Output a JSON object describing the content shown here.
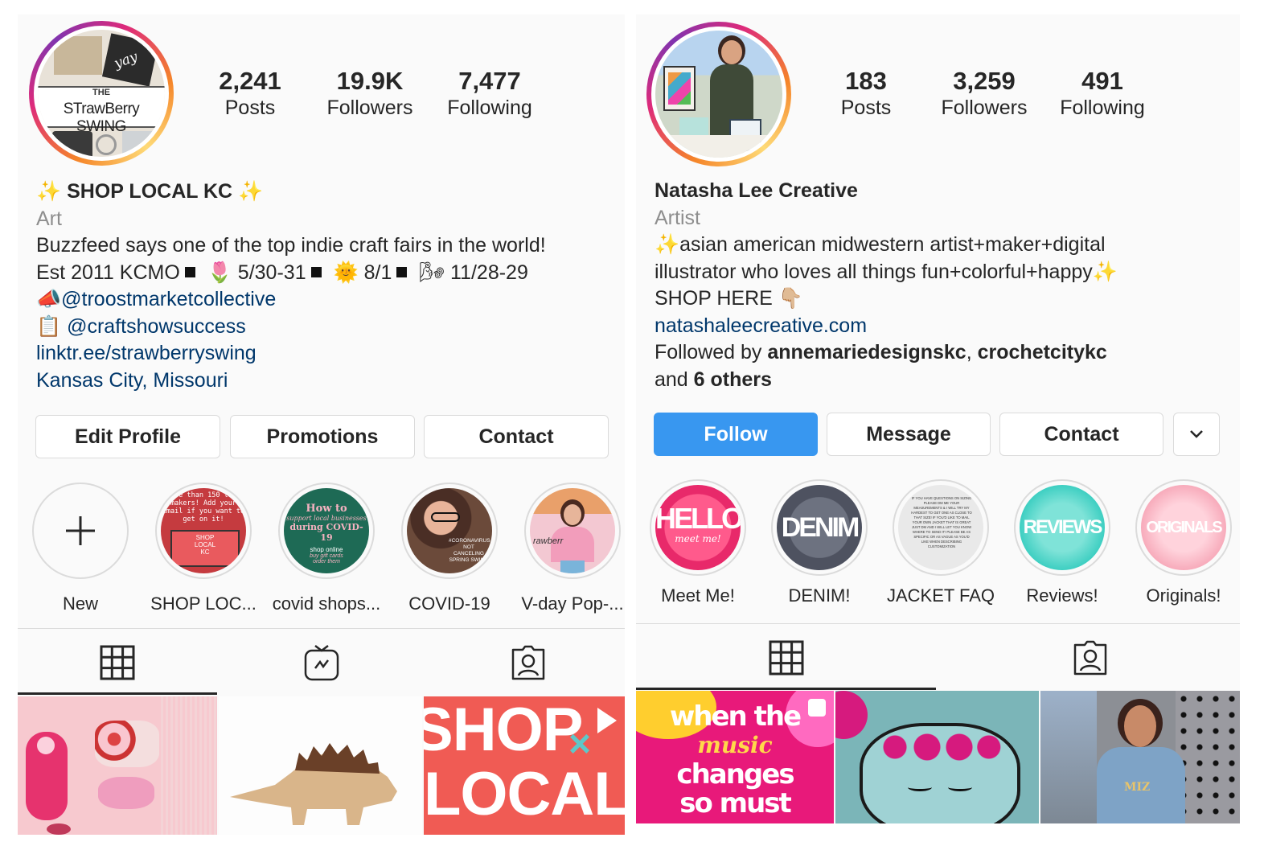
{
  "left": {
    "stats": [
      {
        "num": "2,241",
        "label": "Posts"
      },
      {
        "num": "19.9K",
        "label": "Followers"
      },
      {
        "num": "7,477",
        "label": "Following"
      }
    ],
    "avatar_text": [
      "THE",
      "STrawBerry SWING",
      "yay"
    ],
    "name": "✨ SHOP LOCAL KC ✨",
    "category": "Art",
    "bio_line1": "Buzzfeed says one of the top indie craft fairs in the world!",
    "bio_line2_a": "Est 2011 KCMO",
    "bio_line2_b": "🌷 5/30-31",
    "bio_line2_c": "🌞 8/1",
    "bio_line2_d": "🌬 11/28-29",
    "bio_line3_emoji": "📣",
    "bio_line3_link": "@troostmarketcollective",
    "bio_line4_emoji": "📋",
    "bio_line4_link": "@craftshowsuccess",
    "website": "linktr.ee/strawberryswing",
    "location": "Kansas City, Missouri",
    "buttons": [
      "Edit Profile",
      "Promotions",
      "Contact"
    ],
    "highlights": [
      {
        "label": "New",
        "icon": "plus-icon"
      },
      {
        "label": "SHOP LOC..."
      },
      {
        "label": "covid shops..."
      },
      {
        "label": "COVID-19"
      },
      {
        "label": "V-day Pop-..."
      }
    ],
    "highlight_art": {
      "shop_local": [
        "re than 150 lo",
        "makers! Add your",
        "email if you want to",
        "get on it!",
        "SHOP",
        "LOCAL",
        "KC"
      ],
      "covid_shops": [
        "How to",
        "support local businesses",
        "during COVID-19",
        "shop online",
        "buy gift cards",
        "order them"
      ],
      "covid19": [
        "#CORONAVIRUS",
        "NOT CANCELING",
        "SPRING SWING"
      ],
      "vday": [
        "rawberr"
      ]
    },
    "tiles_text": {
      "shop_local": [
        "SHOP",
        "LOCAL"
      ]
    },
    "icons": {
      "grid": "grid-icon",
      "igtv": "igtv-icon",
      "tagged": "tagged-icon"
    }
  },
  "right": {
    "stats": [
      {
        "num": "183",
        "label": "Posts"
      },
      {
        "num": "3,259",
        "label": "Followers"
      },
      {
        "num": "491",
        "label": "Following"
      }
    ],
    "name": "Natasha Lee Creative",
    "category": "Artist",
    "bio_line1": "✨asian american midwestern artist+maker+digital",
    "bio_line2": "illustrator who loves all things fun+colorful+happy✨",
    "bio_line3": "SHOP HERE 👇🏼",
    "website": "natashaleecreative.com",
    "followed_prefix": "Followed by ",
    "followed_user1": "annemariedesignskc",
    "followed_sep": ", ",
    "followed_user2": "crochetcitykc",
    "followed_and": "and ",
    "followed_others": "6 others",
    "buttons": [
      "Follow",
      "Message",
      "Contact"
    ],
    "highlights": [
      {
        "label": "Meet Me!",
        "art": "HELLO",
        "art_sub": "meet me!"
      },
      {
        "label": "DENIM!",
        "art": "DENIM"
      },
      {
        "label": "JACKET FAQ",
        "art": "IF YOU HAVE QUESTIONS ON SIZING PLEASE DM ME YOUR MEASUREMENTS & I WILL TRY MY HARDEST TO GET ONE AS CLOSE TO THAT SIZE! IF YOU'D LIKE TO MAIL YOUR OWN JACKET THAT IS GREAT JUST DM AND I WILL LET YOU KNOW WHERE TO SEND IT! PLEASE BE AS SPECIFIC OR AS VAGUE AS YOU'D LIKE WHEN DESCRIBING CUSTOMIZATION"
      },
      {
        "label": "Reviews!",
        "art": "REVIEWS"
      },
      {
        "label": "Originals!",
        "art": "ORIGINALS"
      }
    ],
    "tiles_text": {
      "music": [
        "when the",
        "music",
        "changes",
        "so must"
      ],
      "jacket": "MIZ"
    },
    "colors": {
      "follow_blue": "#3897f0",
      "link_blue": "#00376b"
    }
  }
}
